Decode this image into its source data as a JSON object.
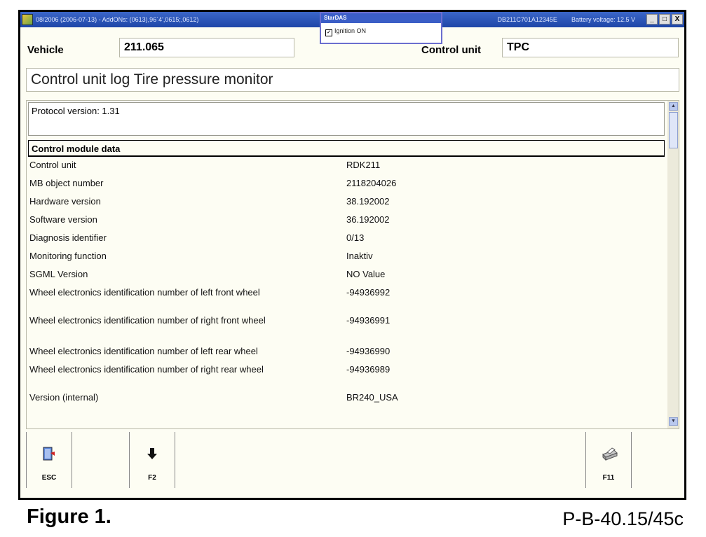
{
  "window": {
    "title_left": "08/2006 (2006-07-13) - AddONs: (0613),96`4',0615;,0612)",
    "title_right": "DB211C701A12345E",
    "battery": "Battery voltage: 12.5 V",
    "btn_min": "_",
    "btn_max": "□",
    "btn_close": "X"
  },
  "startdas": {
    "header": "StarDAS",
    "item": "Ignition ON"
  },
  "vehicle": {
    "label": "Vehicle",
    "value": "211.065"
  },
  "control_unit": {
    "label": "Control unit",
    "value": "TPC"
  },
  "page_title": "Control unit log Tire pressure monitor",
  "protocol": "Protocol version: 1.31",
  "section": "Control module data",
  "rows": [
    {
      "k": "Control unit",
      "v": "RDK211"
    },
    {
      "k": "MB object number",
      "v": "2118204026"
    },
    {
      "k": "Hardware version",
      "v": "38.192002"
    },
    {
      "k": "Software version",
      "v": "36.192002"
    },
    {
      "k": "Diagnosis identifier",
      "v": "0/13"
    },
    {
      "k": "Monitoring function",
      "v": "Inaktiv"
    },
    {
      "k": "SGML Version",
      "v": "NO Value"
    },
    {
      "k": "Wheel electronics identification number of left front wheel",
      "v": "-94936992"
    },
    {
      "k": "Wheel electronics identification number of right front wheel",
      "v": "-94936991"
    },
    {
      "k": "Wheel electronics identification number of left rear wheel",
      "v": "-94936990"
    },
    {
      "k": "Wheel electronics identification number of right rear wheel",
      "v": "-94936989"
    },
    {
      "k": "Version (internal)",
      "v": "BR240_USA"
    }
  ],
  "fkeys": {
    "esc": "ESC",
    "f2": "F2",
    "f11": "F11"
  },
  "caption": {
    "figure": "Figure 1.",
    "code": "P-B-40.15/45c"
  }
}
